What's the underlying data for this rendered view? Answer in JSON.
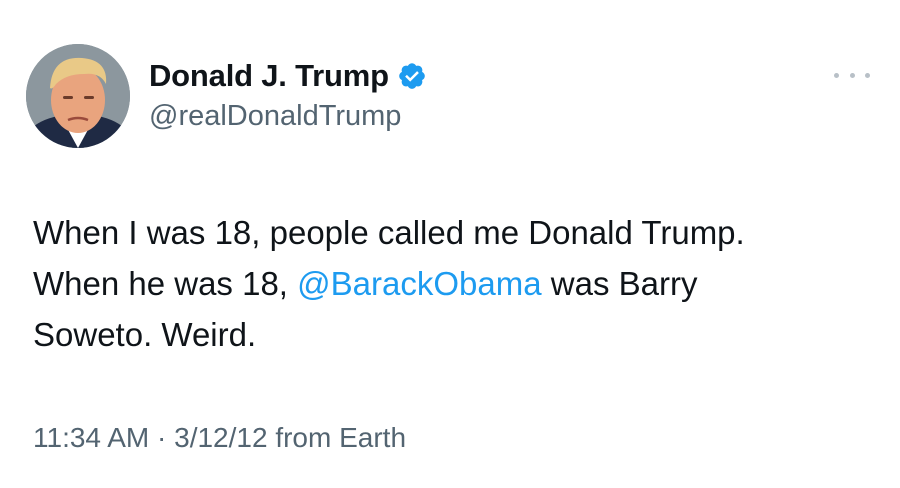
{
  "author": {
    "display_name": "Donald J. Trump",
    "handle": "@realDonaldTrump",
    "verified": true,
    "verified_color": "#1d9bf0"
  },
  "menu": {
    "icon": "more-icon"
  },
  "tweet": {
    "line1": "When I was 18, people called me Donald Trump.",
    "line2_prefix": "When he was 18, ",
    "mention": "@BarackObama",
    "line2_suffix": " was Barry",
    "line3": "Soweto. Weird.",
    "mention_color": "#1d9bf0"
  },
  "meta": {
    "time": "11:34 AM",
    "separator": " · ",
    "date": "3/12/12",
    "source": " from Earth"
  }
}
